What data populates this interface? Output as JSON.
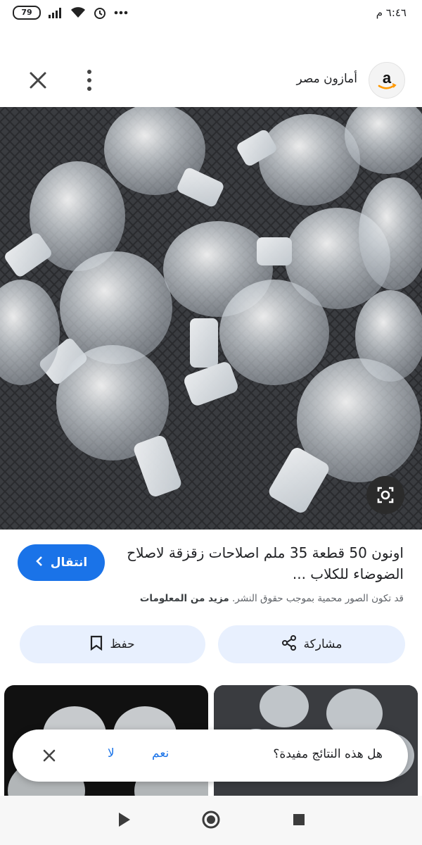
{
  "status_bar": {
    "battery": "79",
    "time": "٦:٤٦ م",
    "icons": [
      "battery-icon",
      "signal-icon",
      "wifi-icon",
      "alarm-icon",
      "more-dots-icon"
    ]
  },
  "header": {
    "site_name": "أمازون مصر",
    "logo_letter": "a",
    "icons": [
      "close-icon",
      "more-vert-icon"
    ]
  },
  "result": {
    "title": "اونون 50 قطعة 35 ملم اصلاحات زقزقة لاصلاح الضوضاء للكلاب ...",
    "visit_label": "انتقال",
    "copyright_text": "قد تكون الصور محمية بموجب حقوق النشر.",
    "learn_more": "مزيد من المعلومات"
  },
  "actions": {
    "share_label": "مشاركة",
    "save_label": "حفظ"
  },
  "feedback": {
    "question": "هل هذه النتائج مفيدة؟",
    "yes_label": "نعم",
    "no_label": "لا"
  },
  "colors": {
    "accent": "#1a73e8",
    "action_bg": "#e8f0fe",
    "image_bg": "#3b3d41"
  }
}
